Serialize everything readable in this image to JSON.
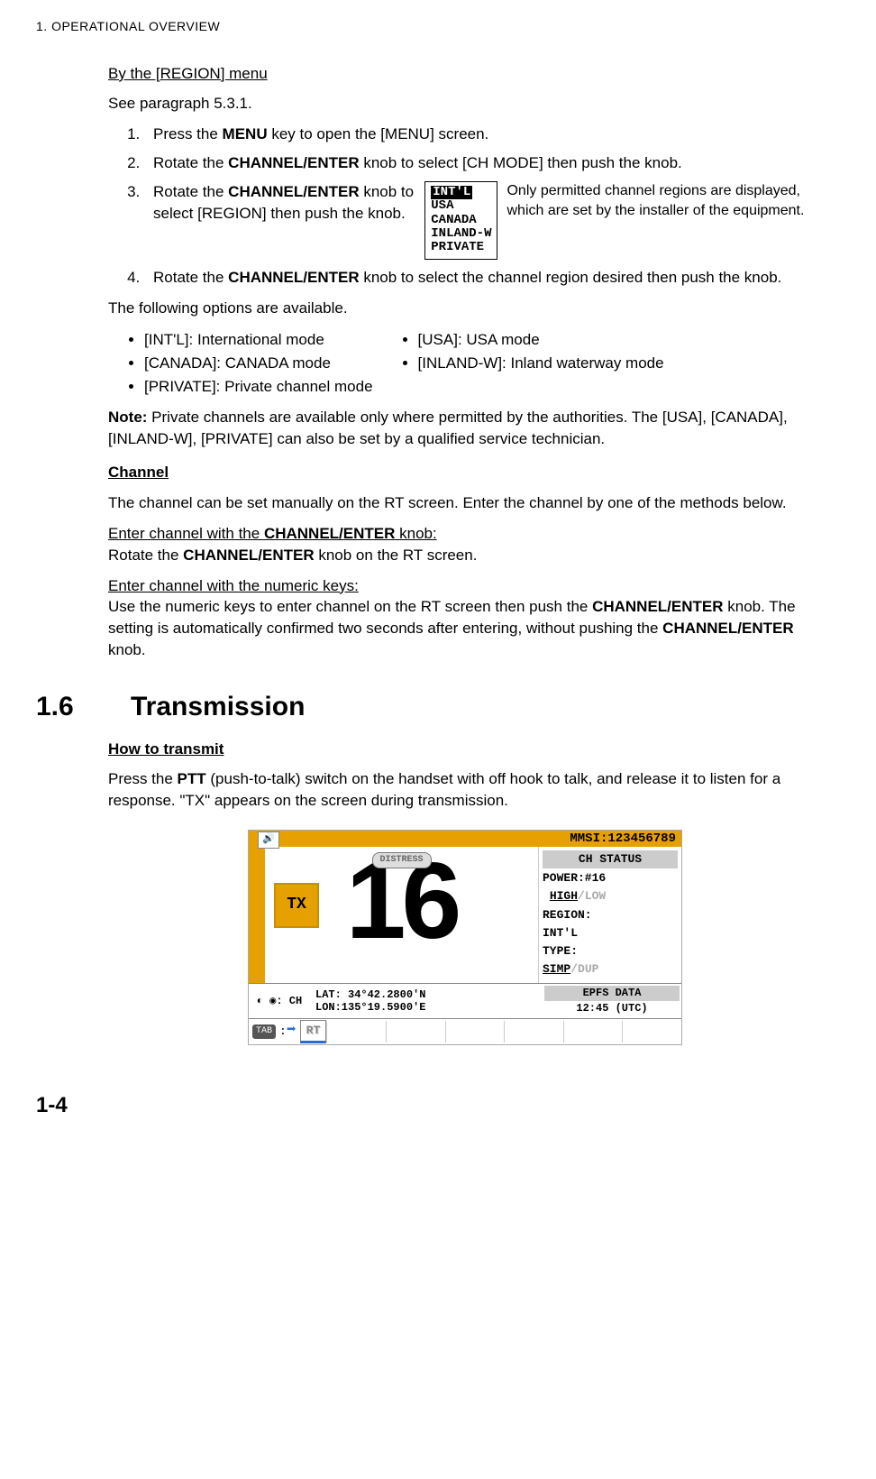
{
  "header": "1.  OPERATIONAL OVERVIEW",
  "region_menu": {
    "title": "By the [REGION] menu",
    "see": "See paragraph 5.3.1.",
    "steps": {
      "1": {
        "pre": "Press the ",
        "bold": "MENU",
        "post": " key to open the [MENU] screen."
      },
      "2": {
        "pre": "Rotate the ",
        "bold": "CHANNEL/ENTER",
        "post": " knob to select [CH MODE] then push the knob."
      },
      "3": {
        "pre": "Rotate the ",
        "bold": "CHANNEL/ENTER",
        "post": " knob to select [REGION] then push the knob."
      },
      "4": {
        "pre": "Rotate the ",
        "bold": "CHANNEL/ENTER",
        "post": " knob to select the channel region desired then push the knob."
      }
    },
    "popup": {
      "sel": "INT'L",
      "l2": "USA",
      "l3": "CANADA",
      "l4": "INLAND-W",
      "l5": "PRIVATE"
    },
    "popup_caption": "Only permitted channel regions are displayed, which are set by the installer of the equipment.",
    "opts_intro": "The following options are available.",
    "opts": {
      "a": "[INT'L]: International mode",
      "b": "[CANADA]: CANADA mode",
      "c": "[PRIVATE]: Private channel mode",
      "d": "[USA]: USA mode",
      "e": "[INLAND-W]: Inland waterway mode"
    },
    "note_bold": "Note:",
    "note": " Private channels are available only where permitted by the authorities. The [USA], [CANADA], [INLAND-W], [PRIVATE] can also be set by a qualified service technician."
  },
  "channel": {
    "title": "Channel",
    "intro": "The channel can be set manually on the RT screen. Enter the channel by one of the methods below.",
    "m1_u": "Enter channel with the ",
    "m1_b": "CHANNEL/ENTER",
    "m1_post": " knob:",
    "m1_body_pre": "Rotate the ",
    "m1_body_b": "CHANNEL/ENTER",
    "m1_body_post": " knob on the RT screen.",
    "m2_u": "Enter channel with the numeric keys:",
    "m2_body_a": "Use the numeric keys to enter channel on the RT screen then push the ",
    "m2_body_b1": "CHANNEL/ENTER",
    "m2_body_c": " knob. The setting is automatically confirmed two seconds after entering, without pushing the ",
    "m2_body_b2": "CHANNEL/ENTER",
    "m2_body_d": " knob."
  },
  "sec16": {
    "num": "1.6",
    "title": "Transmission",
    "sub": "How to transmit",
    "p_a": "Press the ",
    "p_b": "PTT",
    "p_c": " (push-to-talk) switch on the handset with off hook to talk, and release it to listen for a response. \"TX\" appears on the screen during transmission."
  },
  "ss": {
    "mmsi_lbl": "MMSI:",
    "mmsi_val": "123456789",
    "distress": "DISTRESS",
    "ch": "16",
    "tx": "TX",
    "status_hdr": "CH STATUS",
    "power_lbl": "POWER:#16",
    "power_hi": "HIGH",
    "power_lo": "/LOW",
    "region_lbl": "REGION:",
    "region_val": " INT'L",
    "type_lbl": "TYPE:",
    "type_val": " SIMP",
    "type_dim": "/DUP",
    "knob_lbl": ": CH",
    "lat": "LAT: 34°42.2800'N",
    "lon": "LON:135°19.5900'E",
    "epfs_hdr": "EPFS DATA",
    "epfs_val": "12:45 (UTC)",
    "tab": "TAB",
    "colon": " : ",
    "rt": "RT"
  },
  "pagenum": "1-4"
}
